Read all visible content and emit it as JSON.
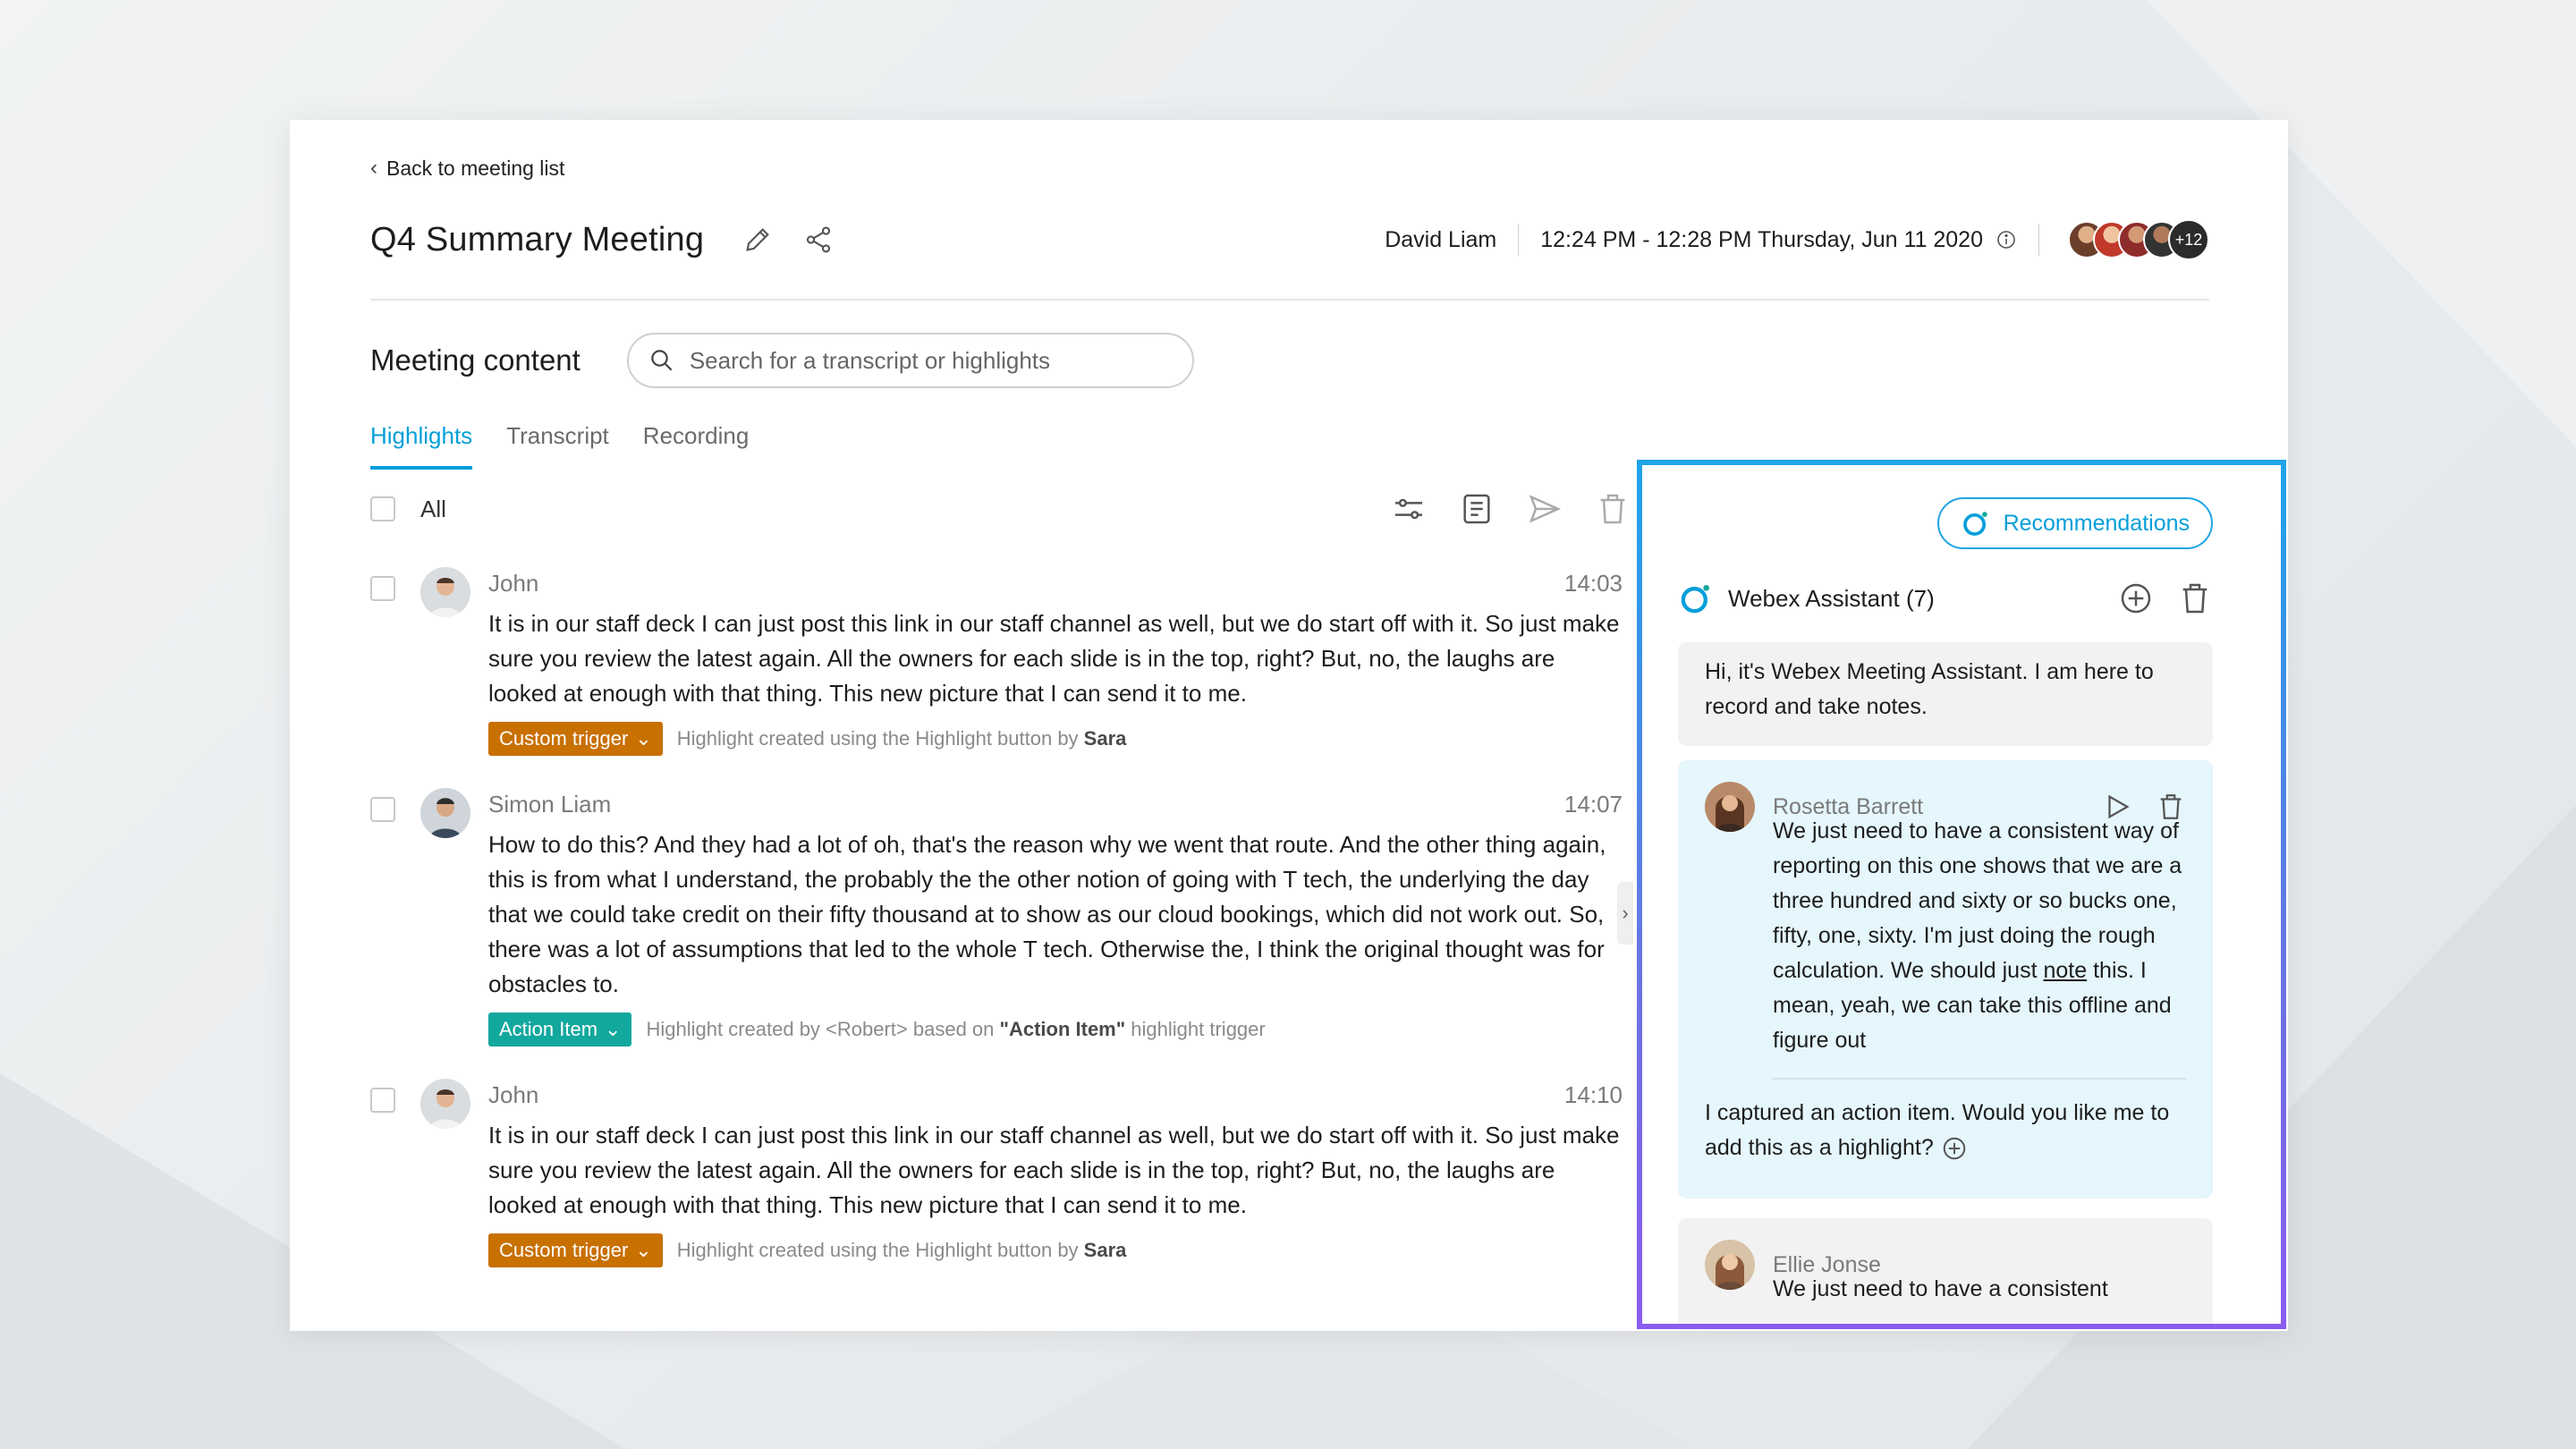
{
  "nav": {
    "back_label": "Back to meeting list"
  },
  "meeting": {
    "title": "Q4 Summary Meeting",
    "host": "David Liam",
    "time": "12:24 PM - 12:28 PM Thursday, Jun 11 2020",
    "more_participants": "+12"
  },
  "content": {
    "label": "Meeting content",
    "search_placeholder": "Search for a transcript or highlights",
    "tabs": [
      {
        "label": "Highlights",
        "active": true
      },
      {
        "label": "Transcript",
        "active": false
      },
      {
        "label": "Recording",
        "active": false
      }
    ],
    "select_all_label": "All"
  },
  "highlights": [
    {
      "speaker": "John",
      "time": "14:03",
      "text": "It is in our staff deck I can just post this link in our staff channel as well, but we do start off with it. So just make sure you review the latest again. All the owners for each slide is in the top, right? But, no, the laughs are looked at enough with that thing. This new picture that I can send it to me.",
      "tag": "Custom trigger",
      "tag_color": "#c87000",
      "note_prefix": "Highlight created using the Highlight button by ",
      "note_bold": "Sara",
      "note_suffix": ""
    },
    {
      "speaker": "Simon Liam",
      "time": "14:07",
      "text": "How to do this? And they had a lot of oh, that's the reason why we went that route. And the other thing again, this is from what I understand, the probably the the other notion of going with T tech, the underlying the day that we could take credit on their fifty thousand at to show as our cloud bookings, which did not work out. So, there was a lot of assumptions that led to the whole T tech. Otherwise the, I think the original thought was for obstacles to.",
      "tag": "Action Item",
      "tag_color": "#13a89e",
      "note_prefix": "Highlight created by <Robert> based on ",
      "note_bold": "\"Action Item\"",
      "note_suffix": " highlight trigger"
    },
    {
      "speaker": "John",
      "time": "14:10",
      "text": "It is in our staff deck I can just post this link in our staff channel as well, but we do start off with it. So just make sure you review the latest again. All the owners for each slide is in the top, right? But, no, the laughs are looked at enough with that thing. This new picture that I can send it to me.",
      "tag": "Custom trigger",
      "tag_color": "#c87000",
      "note_prefix": "Highlight created using the Highlight button by ",
      "note_bold": "Sara",
      "note_suffix": ""
    }
  ],
  "assistant": {
    "recommendations_label": "Recommendations",
    "title": "Webex Assistant (7)",
    "greeting": "Hi, it's Webex Meeting Assistant. I am here to record and take notes.",
    "message1": {
      "speaker": "Rosetta Barrett",
      "text_before": "We just need to have a consistent way of reporting on this one shows that we are a three hundred and sixty or so bucks one, fifty, one, sixty. I'm just doing the rough calculation. We should just ",
      "text_underlined": "note",
      "text_after": " this. I mean, yeah, we can take this offline and figure out",
      "question": "I captured an action item. Would you like me to add this as a highlight?"
    },
    "message2": {
      "speaker": "Ellie Jonse",
      "text": "We just need to have a consistent"
    }
  },
  "colors": {
    "accent": "#049fd9",
    "panel_border_top": "#1fa4e8",
    "panel_border_bottom": "#8a5cf0",
    "highlight_bubble": "#e5f6fc"
  }
}
